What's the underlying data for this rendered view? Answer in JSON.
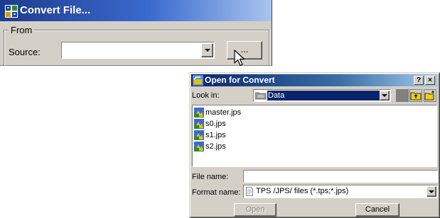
{
  "convert_window": {
    "title": "Convert File...",
    "from_group_label": "From",
    "source_label": "Source:",
    "source_value": "",
    "browse_button_label": "..."
  },
  "open_dialog": {
    "title": "Open for Convert",
    "help_label": "?",
    "close_label": "×",
    "look_in_label": "Look in:",
    "look_in_value": "Data",
    "files": [
      "master.jps",
      "s0.jps",
      "s1.jps",
      "s2.jps"
    ],
    "file_name_label": "File name:",
    "file_name_value": "",
    "format_name_label": "Format name:",
    "format_value": "TPS /JPS/ files (*.tps;*.jps)",
    "open_button": "Open",
    "cancel_button": "Cancel"
  },
  "icons": {
    "app": "app-icon",
    "folder": "folder-icon",
    "file": "jps-file-icon",
    "document": "document-icon",
    "cursor": "mouse-pointer-icon"
  },
  "colors": {
    "title_active": "#0a246a",
    "title_gradient_end": "#a6caf0",
    "face": "#d4d0c8",
    "selection": "#0a246a"
  }
}
